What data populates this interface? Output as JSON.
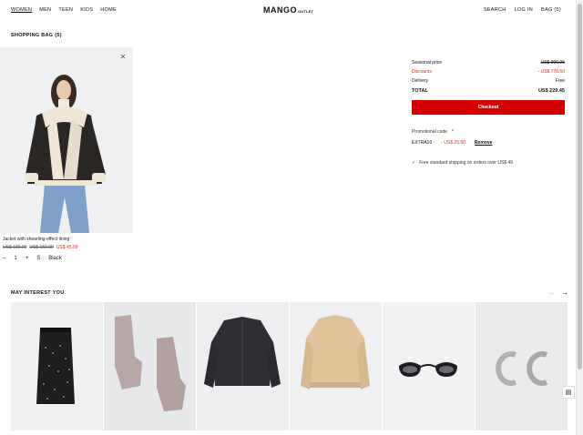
{
  "header": {
    "nav_left": [
      "WOMEN",
      "MEN",
      "TEEN",
      "KIDS",
      "HOME"
    ],
    "logo": "MANGO",
    "logo_sub": "OUTLET",
    "nav_right": [
      "SEARCH",
      "LOG IN",
      "BAG (5)"
    ]
  },
  "bag": {
    "title": "SHOPPING BAG (5)",
    "item": {
      "name": "Jacket with shearling-effect lining",
      "price_original": "US$ 199.99",
      "price_previous": "US$ 159.99",
      "price_sale": "US$ 45.99",
      "quantity": "1",
      "size": "S",
      "color": "Black"
    }
  },
  "summary": {
    "seasonal_label": "Seasonal price",
    "seasonal_value": "US$ 999.95",
    "discounts_label": "Discounts",
    "discounts_value": "- US$ 770.50",
    "delivery_label": "Delivery",
    "delivery_value": "Free",
    "total_label": "TOTAL",
    "total_value": "US$ 229.45",
    "checkout_label": "Checkout",
    "promo_label": "Promotional code",
    "promo_code": "EXTRA10",
    "promo_discount": "- US$ 25.50",
    "promo_remove": "Remove",
    "shipping_note": "Free standard shipping on orders over US$ 49"
  },
  "recommendations": {
    "title": "MAY INTEREST YOU",
    "items": [
      "sequin-skirt",
      "knit-gloves",
      "denim-jacket",
      "bomber-jacket",
      "sunglasses",
      "hoop-earrings"
    ]
  },
  "colors": {
    "accent": "#d40000",
    "discount": "#c8321e"
  }
}
